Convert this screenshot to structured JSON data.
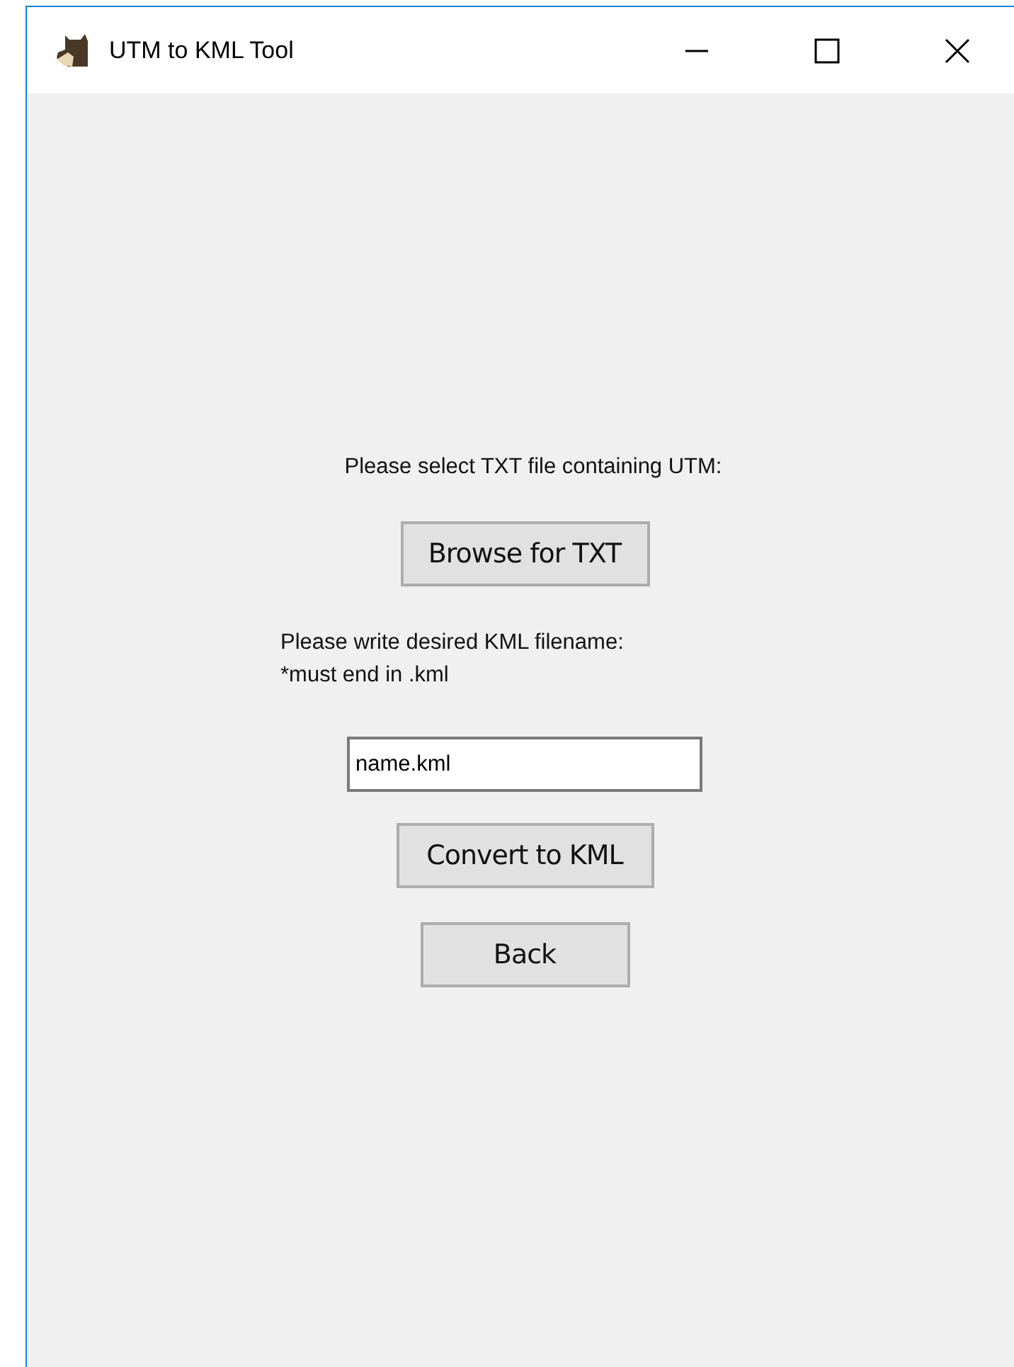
{
  "window": {
    "title": "UTM to KML Tool"
  },
  "prompt": "Please select TXT file containing UTM:",
  "browse_button": "Browse for TXT",
  "filename_label": "Please write desired KML filename:",
  "filename_hint": "*must end in .kml",
  "filename_field": {
    "value": "name.kml"
  },
  "buttons": [
    {
      "label": "Convert to KML",
      "kind": "wide"
    },
    {
      "label": "Back",
      "kind": "narrow"
    }
  ]
}
